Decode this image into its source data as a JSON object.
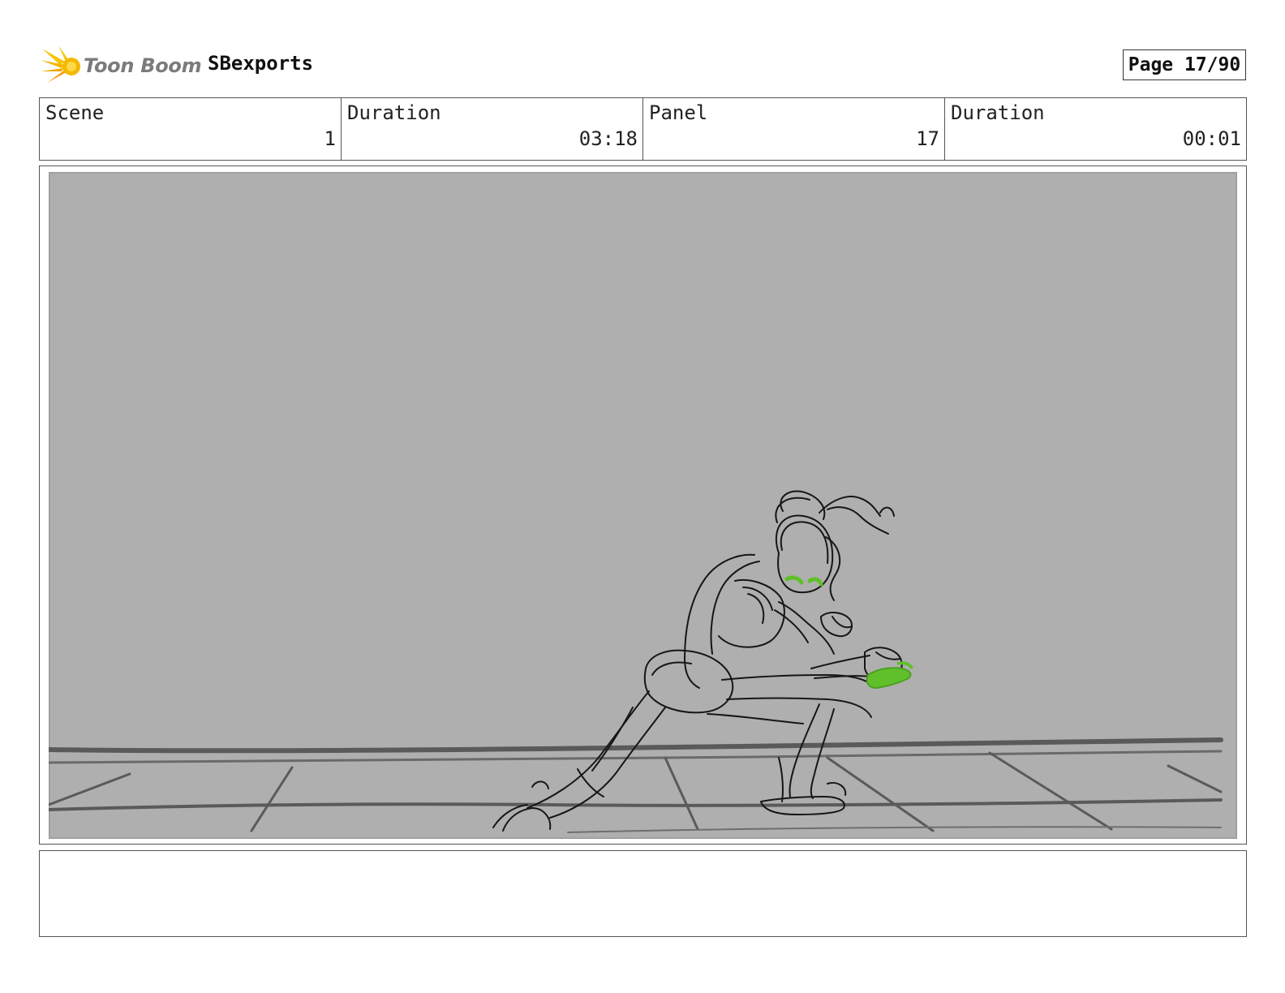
{
  "header": {
    "logo_text": "Toon Boom",
    "project_name": "SBexports",
    "page_label": "Page 17/90"
  },
  "info": {
    "scene_label": "Scene",
    "scene_value": "1",
    "scene_duration_label": "Duration",
    "scene_duration_value": "03:18",
    "panel_label": "Panel",
    "panel_value": "17",
    "panel_duration_label": "Duration",
    "panel_duration_value": "00:01"
  },
  "notes": {
    "text": ""
  },
  "colors": {
    "panel_background": "#afafaf",
    "sketch_line": "#1a1a1a",
    "accent_green": "#5fc02a",
    "logo_yellow": "#f5b800"
  }
}
